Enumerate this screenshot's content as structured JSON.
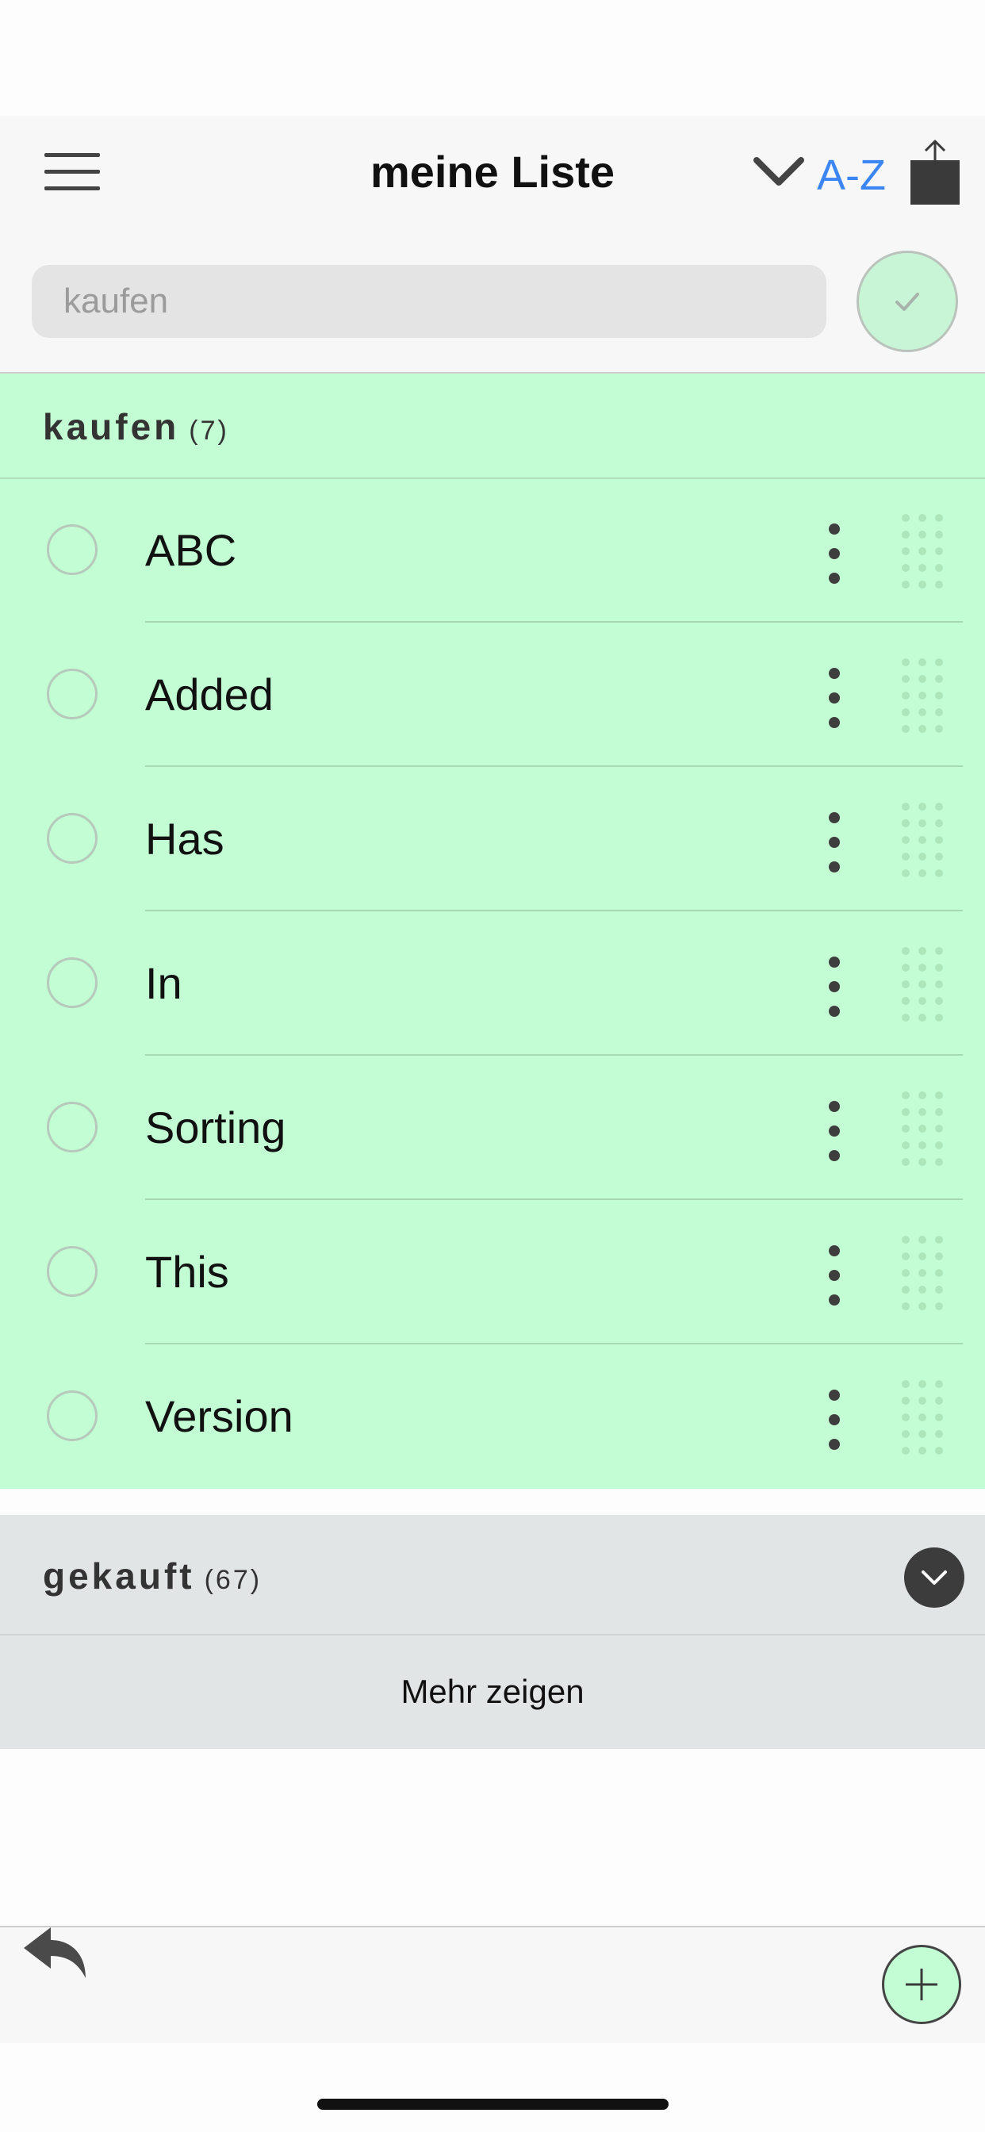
{
  "header": {
    "title": "meine Liste",
    "sort_label": "A-Z",
    "icons": {
      "menu": "hamburger-menu-icon",
      "sort": "chevron-down-icon",
      "share": "share-icon"
    }
  },
  "search": {
    "placeholder": "kaufen",
    "value": ""
  },
  "to_buy": {
    "title": "kaufen",
    "count": "(7)",
    "items": [
      {
        "label": "ABC"
      },
      {
        "label": "Added"
      },
      {
        "label": "Has"
      },
      {
        "label": "In"
      },
      {
        "label": "Sorting"
      },
      {
        "label": "This"
      },
      {
        "label": "Version"
      }
    ]
  },
  "bought": {
    "title": "gekauft",
    "count": "(67)",
    "show_more_label": "Mehr zeigen"
  },
  "colors": {
    "accent": "#3b86f3",
    "section_green": "#c2fdd4",
    "bought_gray": "#e2e5e5"
  }
}
